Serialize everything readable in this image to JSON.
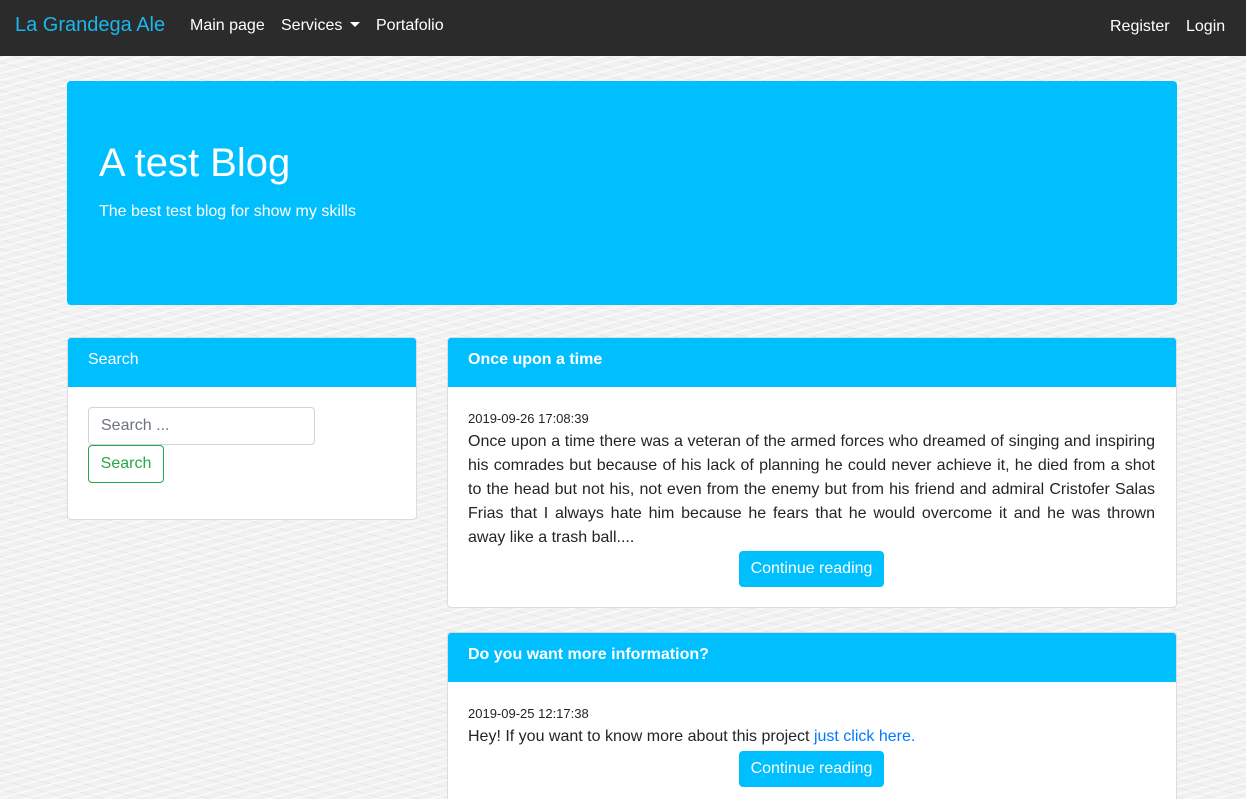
{
  "navbar": {
    "brand": "La Grandega Ale",
    "links": [
      "Main page",
      "Services",
      "Portafolio"
    ],
    "register": "Register",
    "login": "Login"
  },
  "jumbotron": {
    "title": "A test Blog",
    "subtitle": "The best test blog for show my skills"
  },
  "sidebar": {
    "search_title": "Search",
    "search_placeholder": "Search ...",
    "search_button": "Search"
  },
  "posts": [
    {
      "title": "Once upon a time",
      "date": "2019-09-26 17:08:39",
      "body": "Once upon a time there was a veteran of the armed forces who dreamed of singing and inspiring his comrades but because of his lack of planning he could never achieve it, he died from a shot to the head but not his, not even from the enemy but from his friend and admiral Cristofer Salas Frias that I always hate him because he fears that he would overcome it and he was thrown away like a trash ball....",
      "button": "Continue reading"
    },
    {
      "title": "Do you want more information?",
      "date": "2019-09-25 12:17:38",
      "body": "Hey! If you want to know more about this project ",
      "link": "just click here.",
      "button": "Continue reading"
    }
  ],
  "colors": {
    "navbar": "#2b2b2b",
    "brand": "#1ab6ec",
    "accent": "#00bfff",
    "success": "#28a745",
    "link": "#007bff"
  }
}
